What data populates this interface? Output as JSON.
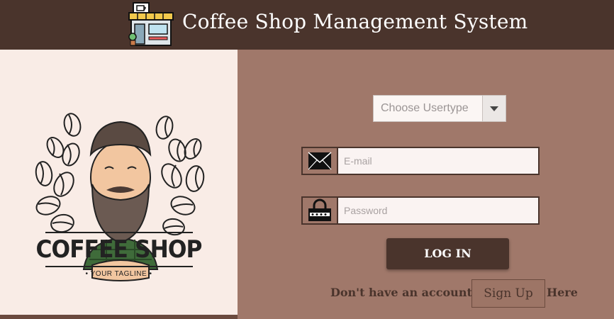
{
  "header": {
    "title": "Coffee Shop Management System",
    "icon": "coffee-shop-storefront-icon"
  },
  "logo": {
    "title": "COFFEE SHOP",
    "tagline": "• YOUR TAGLINE •",
    "image": "bearded-barista-with-coffee-beans"
  },
  "form": {
    "usertype": {
      "selected": "Choose Usertype"
    },
    "email": {
      "placeholder": "E-mail",
      "value": "",
      "icon": "envelope-icon"
    },
    "password": {
      "placeholder": "Password",
      "value": "",
      "icon": "padlock-icon"
    },
    "login_label": "LOG IN",
    "signup_prompt": "Don't have an account?",
    "signup_label": "Sign Up",
    "signup_suffix": "Here"
  },
  "colors": {
    "header": "#4a342c",
    "form_background": "#a0786a",
    "left_panel": "#f9ece6",
    "button": "#4a342c"
  }
}
